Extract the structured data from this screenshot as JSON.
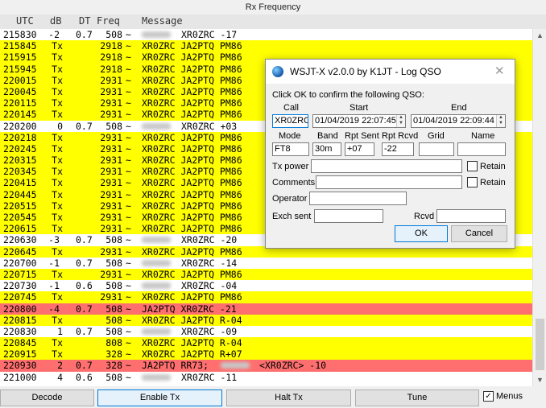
{
  "window": {
    "title": "Rx Frequency"
  },
  "columns": {
    "utc": "UTC",
    "db": "dB",
    "dt": "DT",
    "freq": "Freq",
    "message": "Message"
  },
  "colors": {
    "yellow": "#ffff00",
    "red": "#ff6f6f",
    "white": "#ffffff"
  },
  "rows": [
    {
      "utc": "215830",
      "db": "-2",
      "dt": "0.7",
      "freq": "508",
      "sep": "~",
      "redacted": true,
      "msg": "XR0ZRC -17",
      "color": "white"
    },
    {
      "utc": "215845",
      "db": "Tx",
      "dt": "",
      "freq": "2918",
      "sep": "~",
      "redacted": false,
      "msg": "XR0ZRC JA2PTQ PM86",
      "color": "yellow"
    },
    {
      "utc": "215915",
      "db": "Tx",
      "dt": "",
      "freq": "2918",
      "sep": "~",
      "redacted": false,
      "msg": "XR0ZRC JA2PTQ PM86",
      "color": "yellow"
    },
    {
      "utc": "215945",
      "db": "Tx",
      "dt": "",
      "freq": "2918",
      "sep": "~",
      "redacted": false,
      "msg": "XR0ZRC JA2PTQ PM86",
      "color": "yellow"
    },
    {
      "utc": "220015",
      "db": "Tx",
      "dt": "",
      "freq": "2931",
      "sep": "~",
      "redacted": false,
      "msg": "XR0ZRC JA2PTQ PM86",
      "color": "yellow"
    },
    {
      "utc": "220045",
      "db": "Tx",
      "dt": "",
      "freq": "2931",
      "sep": "~",
      "redacted": false,
      "msg": "XR0ZRC JA2PTQ PM86",
      "color": "yellow"
    },
    {
      "utc": "220115",
      "db": "Tx",
      "dt": "",
      "freq": "2931",
      "sep": "~",
      "redacted": false,
      "msg": "XR0ZRC JA2PTQ PM86",
      "color": "yellow"
    },
    {
      "utc": "220145",
      "db": "Tx",
      "dt": "",
      "freq": "2931",
      "sep": "~",
      "redacted": false,
      "msg": "XR0ZRC JA2PTQ PM86",
      "color": "yellow"
    },
    {
      "utc": "220200",
      "db": "0",
      "dt": "0.7",
      "freq": "508",
      "sep": "~",
      "redacted": true,
      "msg": "XR0ZRC +03",
      "color": "white"
    },
    {
      "utc": "220218",
      "db": "Tx",
      "dt": "",
      "freq": "2931",
      "sep": "~",
      "redacted": false,
      "msg": "XR0ZRC JA2PTQ PM86",
      "color": "yellow"
    },
    {
      "utc": "220245",
      "db": "Tx",
      "dt": "",
      "freq": "2931",
      "sep": "~",
      "redacted": false,
      "msg": "XR0ZRC JA2PTQ PM86",
      "color": "yellow"
    },
    {
      "utc": "220315",
      "db": "Tx",
      "dt": "",
      "freq": "2931",
      "sep": "~",
      "redacted": false,
      "msg": "XR0ZRC JA2PTQ PM86",
      "color": "yellow"
    },
    {
      "utc": "220345",
      "db": "Tx",
      "dt": "",
      "freq": "2931",
      "sep": "~",
      "redacted": false,
      "msg": "XR0ZRC JA2PTQ PM86",
      "color": "yellow"
    },
    {
      "utc": "220415",
      "db": "Tx",
      "dt": "",
      "freq": "2931",
      "sep": "~",
      "redacted": false,
      "msg": "XR0ZRC JA2PTQ PM86",
      "color": "yellow"
    },
    {
      "utc": "220445",
      "db": "Tx",
      "dt": "",
      "freq": "2931",
      "sep": "~",
      "redacted": false,
      "msg": "XR0ZRC JA2PTQ PM86",
      "color": "yellow"
    },
    {
      "utc": "220515",
      "db": "Tx",
      "dt": "",
      "freq": "2931",
      "sep": "~",
      "redacted": false,
      "msg": "XR0ZRC JA2PTQ PM86",
      "color": "yellow"
    },
    {
      "utc": "220545",
      "db": "Tx",
      "dt": "",
      "freq": "2931",
      "sep": "~",
      "redacted": false,
      "msg": "XR0ZRC JA2PTQ PM86",
      "color": "yellow"
    },
    {
      "utc": "220615",
      "db": "Tx",
      "dt": "",
      "freq": "2931",
      "sep": "~",
      "redacted": false,
      "msg": "XR0ZRC JA2PTQ PM86",
      "color": "yellow"
    },
    {
      "utc": "220630",
      "db": "-3",
      "dt": "0.7",
      "freq": "508",
      "sep": "~",
      "redacted": true,
      "msg": "XR0ZRC -20",
      "color": "white"
    },
    {
      "utc": "220645",
      "db": "Tx",
      "dt": "",
      "freq": "2931",
      "sep": "~",
      "redacted": false,
      "msg": "XR0ZRC JA2PTQ PM86",
      "color": "yellow"
    },
    {
      "utc": "220700",
      "db": "-1",
      "dt": "0.7",
      "freq": "508",
      "sep": "~",
      "redacted": true,
      "msg": "XR0ZRC -14",
      "color": "white"
    },
    {
      "utc": "220715",
      "db": "Tx",
      "dt": "",
      "freq": "2931",
      "sep": "~",
      "redacted": false,
      "msg": "XR0ZRC JA2PTQ PM86",
      "color": "yellow"
    },
    {
      "utc": "220730",
      "db": "-1",
      "dt": "0.6",
      "freq": "508",
      "sep": "~",
      "redacted": true,
      "msg": "XR0ZRC -04",
      "color": "white"
    },
    {
      "utc": "220745",
      "db": "Tx",
      "dt": "",
      "freq": "2931",
      "sep": "~",
      "redacted": false,
      "msg": "XR0ZRC JA2PTQ PM86",
      "color": "yellow"
    },
    {
      "utc": "220800",
      "db": "-4",
      "dt": "0.7",
      "freq": "508",
      "sep": "~",
      "redacted": false,
      "msg": "JA2PTQ XR0ZRC -21",
      "color": "red"
    },
    {
      "utc": "220815",
      "db": "Tx",
      "dt": "",
      "freq": "508",
      "sep": "~",
      "redacted": false,
      "msg": "XR0ZRC JA2PTQ R-04",
      "color": "yellow"
    },
    {
      "utc": "220830",
      "db": "1",
      "dt": "0.7",
      "freq": "508",
      "sep": "~",
      "redacted": true,
      "msg": "XR0ZRC -09",
      "color": "white"
    },
    {
      "utc": "220845",
      "db": "Tx",
      "dt": "",
      "freq": "808",
      "sep": "~",
      "redacted": false,
      "msg": "XR0ZRC JA2PTQ R-04",
      "color": "yellow"
    },
    {
      "utc": "220915",
      "db": "Tx",
      "dt": "",
      "freq": "328",
      "sep": "~",
      "redacted": false,
      "msg": "XR0ZRC JA2PTQ R+07",
      "color": "yellow"
    },
    {
      "utc": "220930",
      "db": "2",
      "dt": "0.7",
      "freq": "328",
      "sep": "~",
      "redacted": false,
      "msg": "JA2PTQ RR73;",
      "msg2": "<XR0ZRC> -10",
      "color": "red"
    },
    {
      "utc": "221000",
      "db": "4",
      "dt": "0.6",
      "freq": "508",
      "sep": "~",
      "redacted": true,
      "msg": "XR0ZRC -11",
      "color": "white"
    }
  ],
  "buttons": {
    "decode": "Decode",
    "enable_tx": "Enable Tx",
    "halt_tx": "Halt Tx",
    "tune": "Tune",
    "menus": "Menus"
  },
  "dialog": {
    "title": "WSJT-X   v2.0.0   by K1JT - Log QSO",
    "prompt": "Click OK to confirm the following QSO:",
    "labels": {
      "call": "Call",
      "start": "Start",
      "end": "End",
      "mode": "Mode",
      "band": "Band",
      "rpt_sent": "Rpt Sent",
      "rpt_rcvd": "Rpt Rcvd",
      "grid": "Grid",
      "name": "Name",
      "tx_power": "Tx power",
      "comments": "Comments",
      "operator": "Operator",
      "exch_sent": "Exch sent",
      "rcvd": "Rcvd",
      "retain": "Retain"
    },
    "values": {
      "call": "XR0ZRC",
      "start": "01/04/2019 22:07:45",
      "end": "01/04/2019 22:09:44",
      "mode": "FT8",
      "band": "30m",
      "rpt_sent": "+07",
      "rpt_rcvd": "-22",
      "grid": "",
      "name": "",
      "tx_power": "",
      "comments": "",
      "operator": "",
      "exch_sent": "",
      "rcvd": ""
    },
    "ok": "OK",
    "cancel": "Cancel"
  }
}
